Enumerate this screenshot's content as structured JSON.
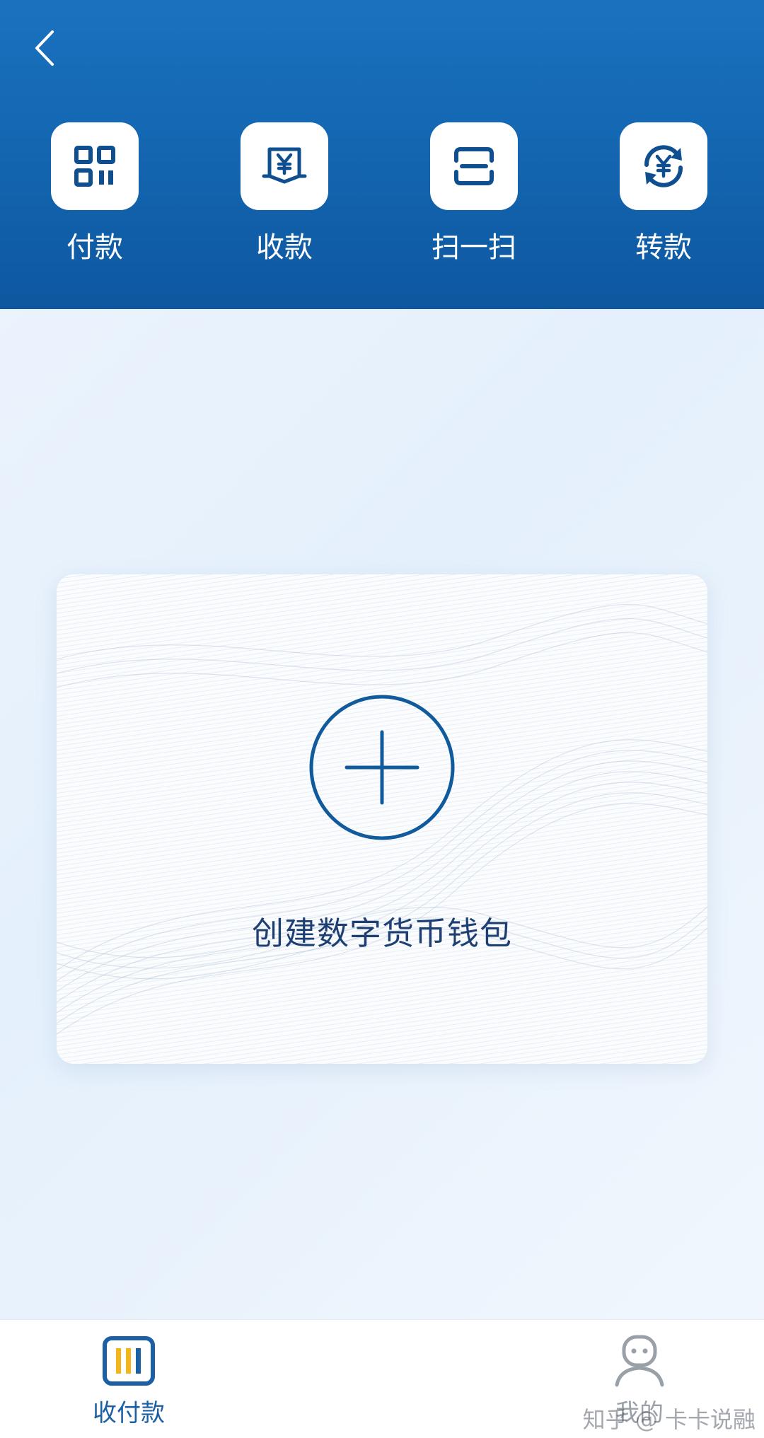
{
  "colors": {
    "header_bg": "#1364ae",
    "accent": "#1b5fa5",
    "icon_blue": "#0f4f8f",
    "nav_yellow": "#f2b61c",
    "inactive": "#9aa0a8"
  },
  "header": {
    "back_icon": "chevron-left-icon",
    "actions": [
      {
        "label": "付款",
        "icon": "qr-code-icon"
      },
      {
        "label": "收款",
        "icon": "yuan-receipt-icon"
      },
      {
        "label": "扫一扫",
        "icon": "scan-icon"
      },
      {
        "label": "转款",
        "icon": "yuan-transfer-icon"
      }
    ]
  },
  "wallet_card": {
    "icon": "plus-circle-icon",
    "label": "创建数字货币钱包"
  },
  "bottom_nav": {
    "items": [
      {
        "label": "收付款",
        "icon": "wallet-bars-icon",
        "active": true
      },
      {
        "label": "我的",
        "icon": "user-icon",
        "active": false
      }
    ]
  },
  "watermark": "知乎 @ 卡卡说融"
}
